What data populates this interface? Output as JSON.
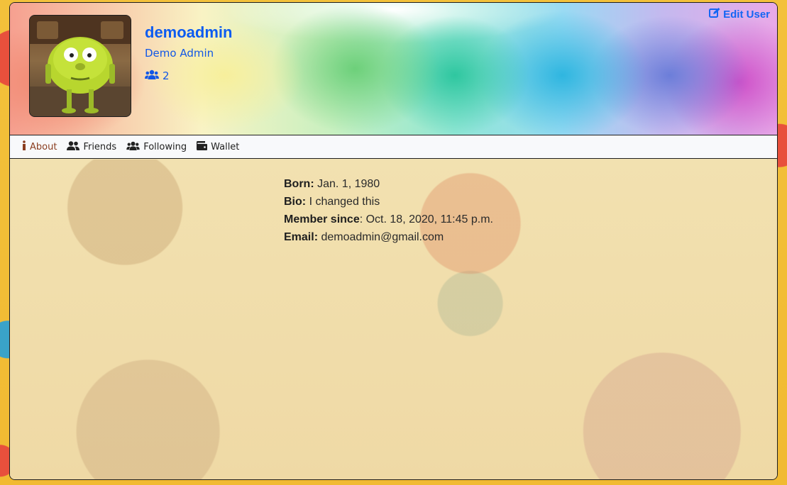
{
  "profile": {
    "username": "demoadmin",
    "full_name": "Demo Admin",
    "follower_count": "2",
    "edit_label": "Edit User"
  },
  "tabs": [
    {
      "label": "About",
      "icon": "info-icon",
      "active": true
    },
    {
      "label": "Friends",
      "icon": "friends-icon",
      "active": false
    },
    {
      "label": "Following",
      "icon": "users-icon",
      "active": false
    },
    {
      "label": "Wallet",
      "icon": "wallet-icon",
      "active": false
    }
  ],
  "about": {
    "born_label": "Born:",
    "born_value": "Jan. 1, 1980",
    "bio_label": "Bio:",
    "bio_value": "I changed this",
    "member_label": "Member since",
    "member_value": ": Oct. 18, 2020, 11:45 p.m.",
    "email_label": "Email:",
    "email_value": "demoadmin@gmail.com"
  },
  "colors": {
    "link_blue": "#0d5cf0",
    "active_tab": "#8a3d1f",
    "tab_bar": "#f8f9fb"
  }
}
